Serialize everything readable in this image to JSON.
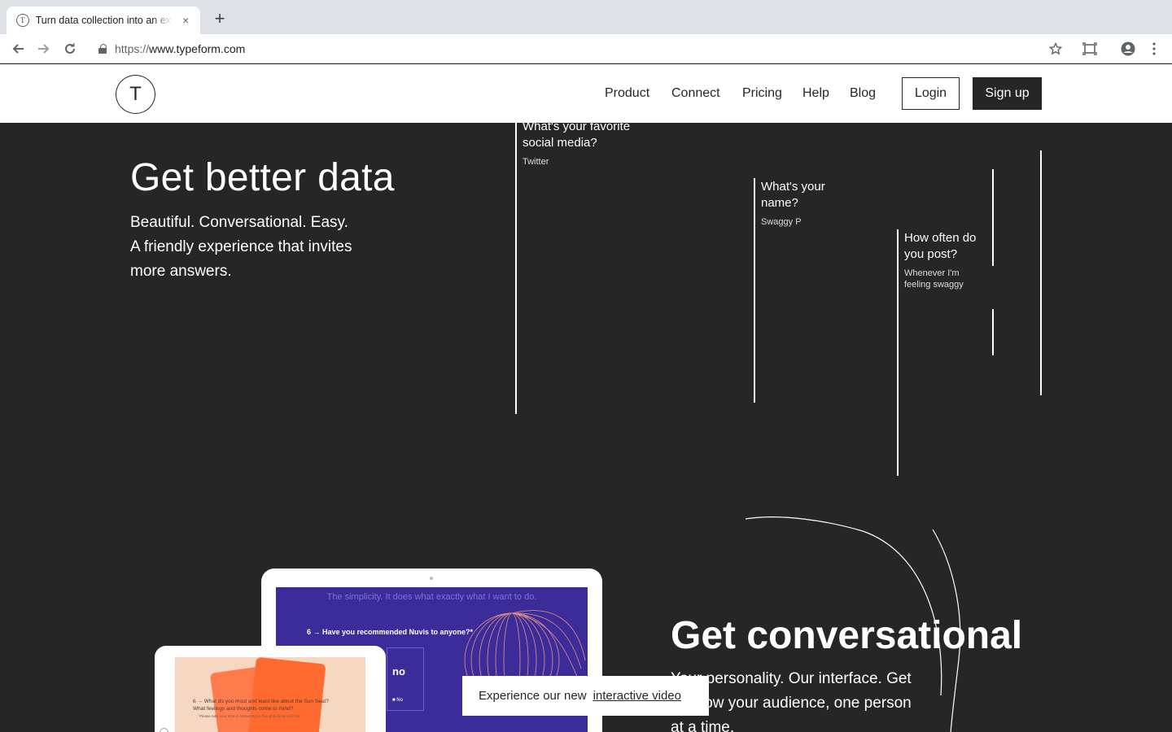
{
  "browser": {
    "tab_title": "Turn data collection into an experience",
    "tab_favicon_letter": "T",
    "new_tab_symbol": "+",
    "close_symbol": "×",
    "url_protocol": "https://",
    "url_host": "www.typeform.com"
  },
  "header": {
    "logo_letter": "T",
    "nav": [
      "Product",
      "Connect",
      "Pricing",
      "Help",
      "Blog"
    ],
    "login_label": "Login",
    "signup_label": "Sign up"
  },
  "hero": {
    "title": "Get better data",
    "subtitle_lines": [
      "Beautiful. Conversational. Easy.",
      "A friendly experience that invites",
      "more answers."
    ]
  },
  "questions": [
    {
      "question": "What's your favorite social media?",
      "answer": "Twitter"
    },
    {
      "question": "What's your name?",
      "answer": "Swaggy P"
    },
    {
      "question": "How often do you post?",
      "answer": "Whenever I'm feeling swaggy"
    }
  ],
  "section2": {
    "title": "Get conversational",
    "subtitle": "Your personality. Our interface. Get to know your audience, one person at a time."
  },
  "device_big": {
    "faded_text": "The simplicity. It does what exactly what I want to do.",
    "question": "6 → Have you recommended Nuvis to anyone?*",
    "choice_label": "no",
    "choice_small": "■ No"
  },
  "device_small": {
    "question": "6 → What do you most and least like about the Sun Seat? What feelings and thoughts come to mind?",
    "hint": "Please take your time in answering as thoughtfully as you can."
  },
  "video_banner": {
    "prefix": "Experience our new",
    "link_label": "interactive video"
  },
  "colors": {
    "background": "#262627",
    "header_bg": "#ffffff",
    "device_screen_blue": "#3c2c9a",
    "device_screen_peach": "#f6d7c2",
    "accent_orange": "#ff6a2f"
  }
}
